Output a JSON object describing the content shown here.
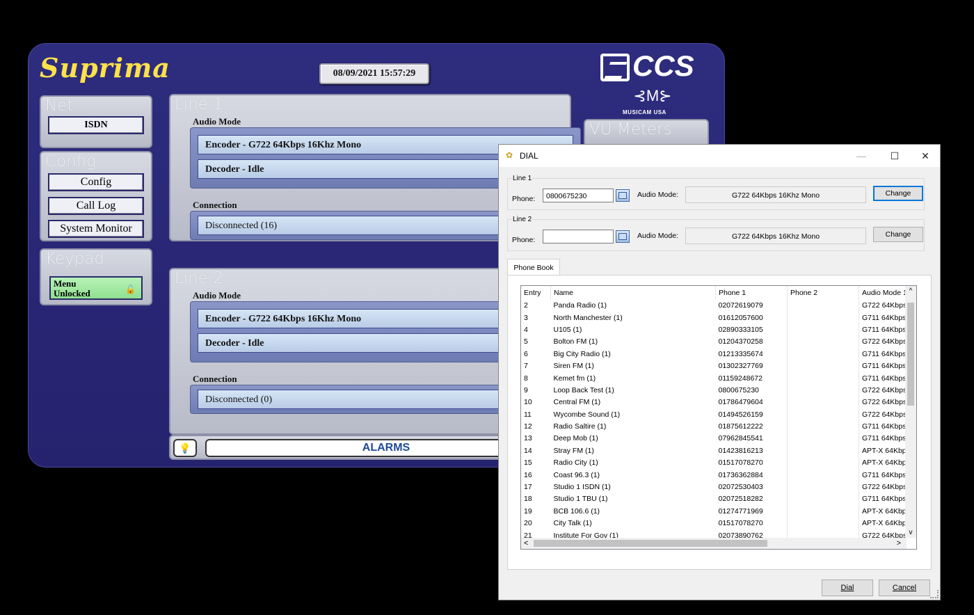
{
  "app": {
    "brand": "Suprima",
    "datetime": "08/09/2021 15:57:29",
    "logo_text": "CCS",
    "logo_subtext": "MUSICAM USA"
  },
  "left": {
    "net": {
      "title": "Net",
      "isdn_label": "ISDN"
    },
    "config": {
      "title": "Config",
      "buttons": [
        "Config",
        "Call Log",
        "System Monitor"
      ]
    },
    "keypad": {
      "title": "Keypad",
      "menu_line1": "Menu",
      "menu_line2": "Unlocked"
    }
  },
  "lines": [
    {
      "title": "Line 1",
      "audio_mode_label": "Audio Mode",
      "encoder": "Encoder -  G722 64Kbps 16Khz Mono",
      "decoder": "Decoder -  Idle",
      "connection_label": "Connection",
      "connection": "Disconnected (16)"
    },
    {
      "title": "Line 2",
      "audio_mode_label": "Audio Mode",
      "encoder": "Encoder -  G722 64Kbps 16Khz Mono",
      "decoder": "Decoder -  Idle",
      "connection_label": "Connection",
      "connection": "Disconnected (0)"
    }
  ],
  "vu": {
    "title": "VU Meters"
  },
  "alarms": {
    "label": "ALARMS"
  },
  "dial": {
    "title": "DIAL",
    "controls": {
      "minimize": "—",
      "maximize": "☐",
      "close": "✕"
    },
    "line1": {
      "group_label": "Line 1",
      "phone_label": "Phone:",
      "phone_value": "0800675230",
      "audio_mode_label": "Audio Mode:",
      "audio_mode": "G722 64Kbps 16Khz Mono",
      "change_label": "Change"
    },
    "line2": {
      "group_label": "Line 2",
      "phone_label": "Phone:",
      "phone_value": "",
      "audio_mode_label": "Audio Mode:",
      "audio_mode": "G722 64Kbps 16Khz Mono",
      "change_label": "Change"
    },
    "tab_label": "Phone Book",
    "columns": [
      "Entry",
      "Name",
      "Phone 1",
      "Phone 2",
      "Audio Mode 1"
    ],
    "rows": [
      [
        "2",
        "Panda Radio (1)",
        "02072619079",
        "",
        "G722 64Kbps"
      ],
      [
        "3",
        "North Manchester (1)",
        "01612057600",
        "",
        "G711 64Kbps"
      ],
      [
        "4",
        "U105 (1)",
        "02890333105",
        "",
        "G711 64Kbps"
      ],
      [
        "5",
        "Bolton FM (1)",
        "01204370258",
        "",
        "G722 64Kbps"
      ],
      [
        "6",
        "Big City Radio (1)",
        "01213335674",
        "",
        "G711 64Kbps"
      ],
      [
        "7",
        "Siren FM (1)",
        "01302327769",
        "",
        "G711 64Kbps"
      ],
      [
        "8",
        "Kemet fm (1)",
        "01159248672",
        "",
        "G711 64Kbps"
      ],
      [
        "9",
        "Loop Back Test (1)",
        "0800675230",
        "",
        "G722 64Kbps"
      ],
      [
        "10",
        "Central FM (1)",
        "01786479604",
        "",
        "G722 64Kbps"
      ],
      [
        "11",
        "Wycombe Sound (1)",
        "01494526159",
        "",
        "G722 64Kbps"
      ],
      [
        "12",
        "Radio Saltire (1)",
        "01875612222",
        "",
        "G711 64Kbps"
      ],
      [
        "13",
        "Deep Mob (1)",
        "07962845541",
        "",
        "G711 64Kbps"
      ],
      [
        "14",
        "Stray FM (1)",
        "01423816213",
        "",
        "APT-X 64Kbp"
      ],
      [
        "15",
        "Radio City (1)",
        "01517078270",
        "",
        "APT-X 64Kbp"
      ],
      [
        "16",
        "Coast 96.3 (1)",
        "01736362884",
        "",
        "G711 64Kbps"
      ],
      [
        "17",
        "Studio 1 ISDN (1)",
        "02072530403",
        "",
        "G722 64Kbps"
      ],
      [
        "18",
        "Studio 1 TBU (1)",
        "02072518282",
        "",
        "G711 64Kbps"
      ],
      [
        "19",
        "BCB 106.6 (1)",
        "01274771969",
        "",
        "APT-X 64Kbp"
      ],
      [
        "20",
        "City Talk (1)",
        "01517078270",
        "",
        "APT-X 64Kbp"
      ],
      [
        "21",
        "Institute For Gov (1)",
        "02073890762",
        "",
        "G722 64Kbps"
      ]
    ],
    "dial_label": "Dial",
    "cancel_label": "Cancel"
  }
}
